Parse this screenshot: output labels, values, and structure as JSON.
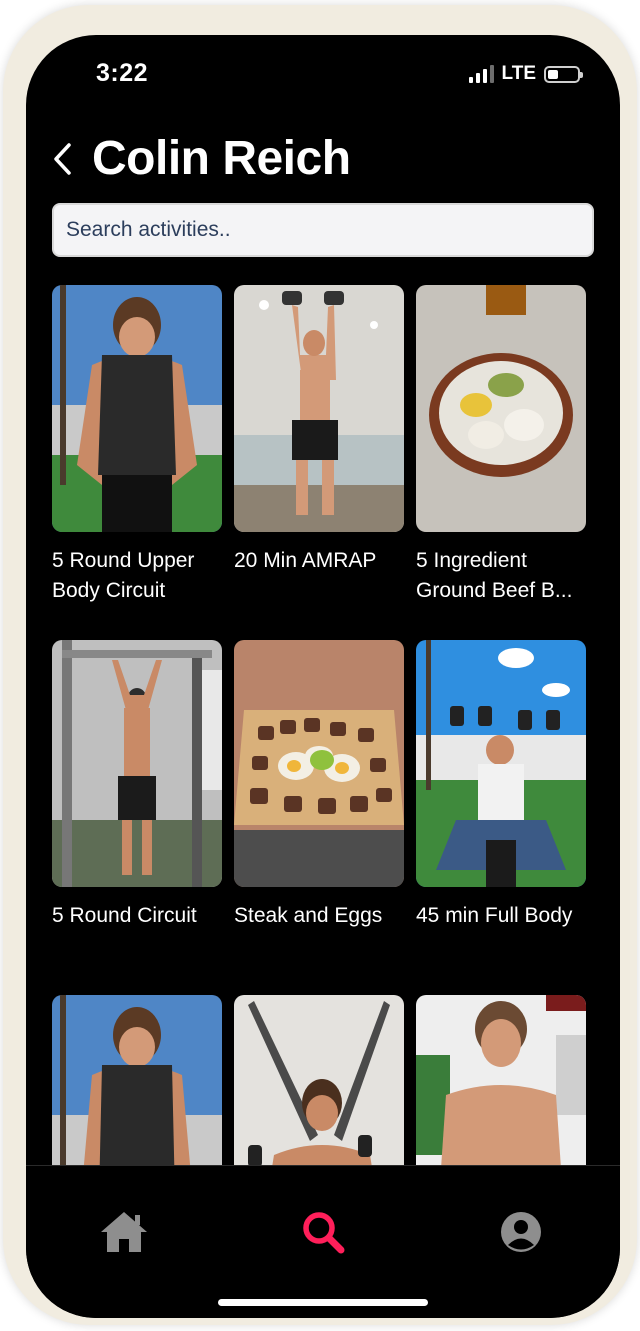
{
  "status_bar": {
    "time": "3:22",
    "network": "LTE"
  },
  "header": {
    "back_icon": "chevron-left-icon",
    "title": "Colin Reich"
  },
  "search": {
    "placeholder": "Search activities.."
  },
  "activities": [
    {
      "title": "5 Round Upper Body Circuit"
    },
    {
      "title": "20 Min AMRAP"
    },
    {
      "title": "5 Ingredient Ground Beef B..."
    },
    {
      "title": "5 Round Circuit"
    },
    {
      "title": "Steak and Eggs"
    },
    {
      "title": "45 min Full Body"
    },
    {
      "title": ""
    },
    {
      "title": ""
    },
    {
      "title": ""
    }
  ],
  "bottom_nav": {
    "items": [
      {
        "icon": "home-icon",
        "active": false
      },
      {
        "icon": "search-icon",
        "active": true
      },
      {
        "icon": "profile-icon",
        "active": false
      }
    ],
    "active_color": "#ff1f5a",
    "inactive_color": "#8e8e8e"
  }
}
